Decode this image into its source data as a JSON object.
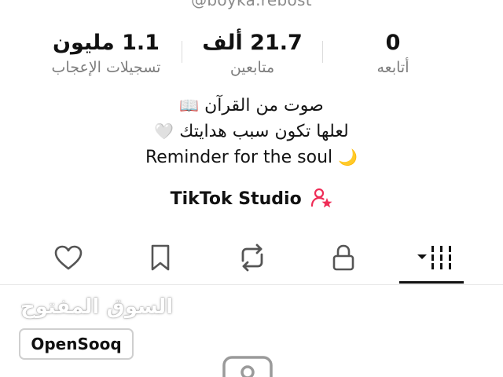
{
  "profile": {
    "handle": "@boyka.rebost"
  },
  "stats": {
    "likes": {
      "value": "1.1 مليون",
      "label": "تسجيلات الإعجاب"
    },
    "followers": {
      "value": "21.7 ألف",
      "label": "متابعين"
    },
    "following": {
      "value": "0",
      "label": "أتابعه"
    }
  },
  "bio": {
    "line1": "صوت من القرآن",
    "line1_emoji": "📖",
    "line2": "لعلها تكون سبب هدايتك",
    "line2_emoji": "🤍",
    "line3": "Reminder for the soul",
    "line3_emoji": "🌙"
  },
  "studio": {
    "label": "TikTok Studio",
    "icon": "person-star-icon",
    "icon_color": "#ef2c56"
  },
  "tabs": [
    {
      "name": "liked",
      "icon": "heart-icon"
    },
    {
      "name": "saved",
      "icon": "bookmark-icon"
    },
    {
      "name": "reposts",
      "icon": "repost-icon"
    },
    {
      "name": "private",
      "icon": "lock-icon"
    },
    {
      "name": "videos",
      "icon": "grid-icon",
      "selected": true
    }
  ],
  "watermark": {
    "arabic": "السوق المفتوح",
    "brand": "OpenSooq"
  },
  "colors": {
    "text": "#111111",
    "muted": "#7d7d7d",
    "icon": "#555555",
    "accent": "#ef2c56"
  }
}
